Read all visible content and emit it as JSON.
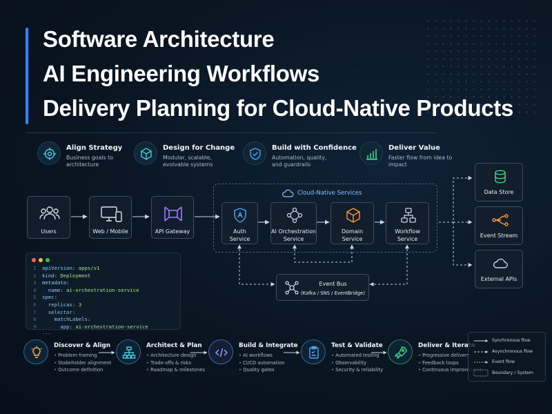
{
  "title": {
    "line1": "Software Architecture",
    "line2": "AI Engineering Workflows",
    "line3": "Delivery Planning for Cloud-Native Products"
  },
  "features": [
    {
      "title": "Align Strategy",
      "desc": "Business goals to architecture",
      "icon": "target-icon"
    },
    {
      "title": "Design for Change",
      "desc": "Modular, scalable, evolvable systems",
      "icon": "cube-icon"
    },
    {
      "title": "Build with Confidence",
      "desc": "Automation, quality, and guardrails",
      "icon": "shield-check-icon"
    },
    {
      "title": "Deliver Value",
      "desc": "Faster flow from idea to impact",
      "icon": "bar-chart-icon"
    }
  ],
  "diagram": {
    "users": "Users",
    "web": "Web / Mobile",
    "gateway": "API Gateway",
    "cloud_label": "Cloud-Native Services",
    "auth": [
      "Auth",
      "Service"
    ],
    "ai": [
      "AI Orchestration",
      "Service"
    ],
    "domain": [
      "Domain",
      "Service"
    ],
    "workflow": [
      "Workflow",
      "Service"
    ],
    "event_bus": "Event Bus",
    "event_bus_sub": "(Kafka / SNS / EventBridge)",
    "data_store": "Data Store",
    "event_stream": "Event Stream",
    "external_apis": "External APIs"
  },
  "code": {
    "lines": [
      {
        "n": "1",
        "k": "apiVersion",
        "v": "apps/v1"
      },
      {
        "n": "2",
        "k": "kind",
        "v": "Deployment"
      },
      {
        "n": "3",
        "k": "metadata",
        "v": ""
      },
      {
        "n": "4",
        "k": "  name",
        "v": "ai-orchestration-service"
      },
      {
        "n": "5",
        "k": "spec",
        "v": ""
      },
      {
        "n": "6",
        "k": "  replicas",
        "v": "3"
      },
      {
        "n": "7",
        "k": "  selector",
        "v": ""
      },
      {
        "n": "8",
        "k": "    matchLabels",
        "v": ""
      },
      {
        "n": "9",
        "k": "      app",
        "v": "ai-orchestration-service"
      }
    ],
    "ellipsis": "..."
  },
  "steps": [
    {
      "title": "Discover & Align",
      "items": [
        "Problem framing",
        "Stakeholder alignment",
        "Outcome definition"
      ],
      "icon": "lightbulb-icon"
    },
    {
      "title": "Architect & Plan",
      "items": [
        "Architecture design",
        "Trade-offs & risks",
        "Roadmap & milestones"
      ],
      "icon": "hierarchy-icon"
    },
    {
      "title": "Build & Integrate",
      "items": [
        "AI workflows",
        "CI/CD automation",
        "Quality gates"
      ],
      "icon": "code-icon"
    },
    {
      "title": "Test & Validate",
      "items": [
        "Automated testing",
        "Observability",
        "Security & reliability"
      ],
      "icon": "clipboard-check-icon"
    },
    {
      "title": "Deliver & Iterate",
      "items": [
        "Progressive delivery",
        "Feedback loops",
        "Continuous improvement"
      ],
      "icon": "rocket-icon"
    }
  ],
  "legend": {
    "sync": "Synchronous flow",
    "async": "Asynchronous flow",
    "event": "Event flow",
    "boundary": "Boundary / System"
  },
  "colors": {
    "accent": "#2f86ff",
    "cyan": "#3fd0e0",
    "purple": "#a07cff",
    "orange": "#ff9a3c",
    "green": "#3ddc84"
  }
}
